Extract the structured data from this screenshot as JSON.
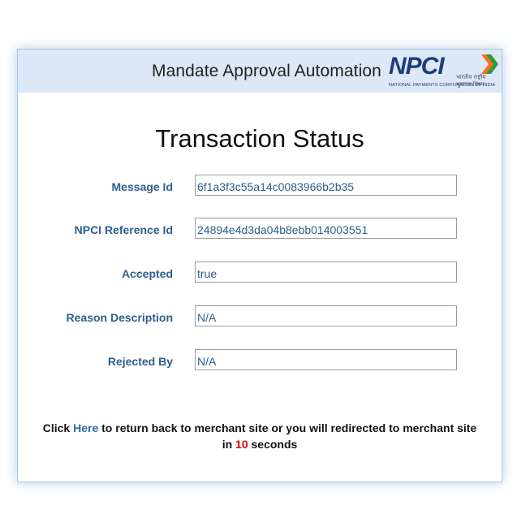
{
  "header": {
    "title": "Mandate Approval Automation",
    "logo": {
      "text": "NPCI",
      "hindi": "भारतीय राष्ट्रीय भुगतान निगम",
      "subtitle": "NATIONAL PAYMENTS CORPORATION OF INDIA"
    }
  },
  "page_title": "Transaction Status",
  "fields": [
    {
      "label": "Message Id",
      "value": "6f1a3f3c55a14c0083966b2b35"
    },
    {
      "label": "NPCI Reference Id",
      "value": "24894e4d3da04b8ebb014003551"
    },
    {
      "label": "Accepted",
      "value": "true"
    },
    {
      "label": "Reason Description",
      "value": "N/A"
    },
    {
      "label": "Rejected By",
      "value": "N/A"
    }
  ],
  "footer": {
    "prefix": "Click",
    "link": "Here",
    "middle": "to return back to merchant site or you will redirected to merchant site",
    "in": "in",
    "seconds_value": "10",
    "seconds_label": "seconds"
  },
  "colors": {
    "header_bg": "#dde8f6",
    "label": "#2e5f8e",
    "link": "#2e6aa8",
    "countdown": "#e00000",
    "npci_blue": "#1f3d7a",
    "npci_orange": "#f26f21",
    "npci_green": "#2b9a3b"
  }
}
